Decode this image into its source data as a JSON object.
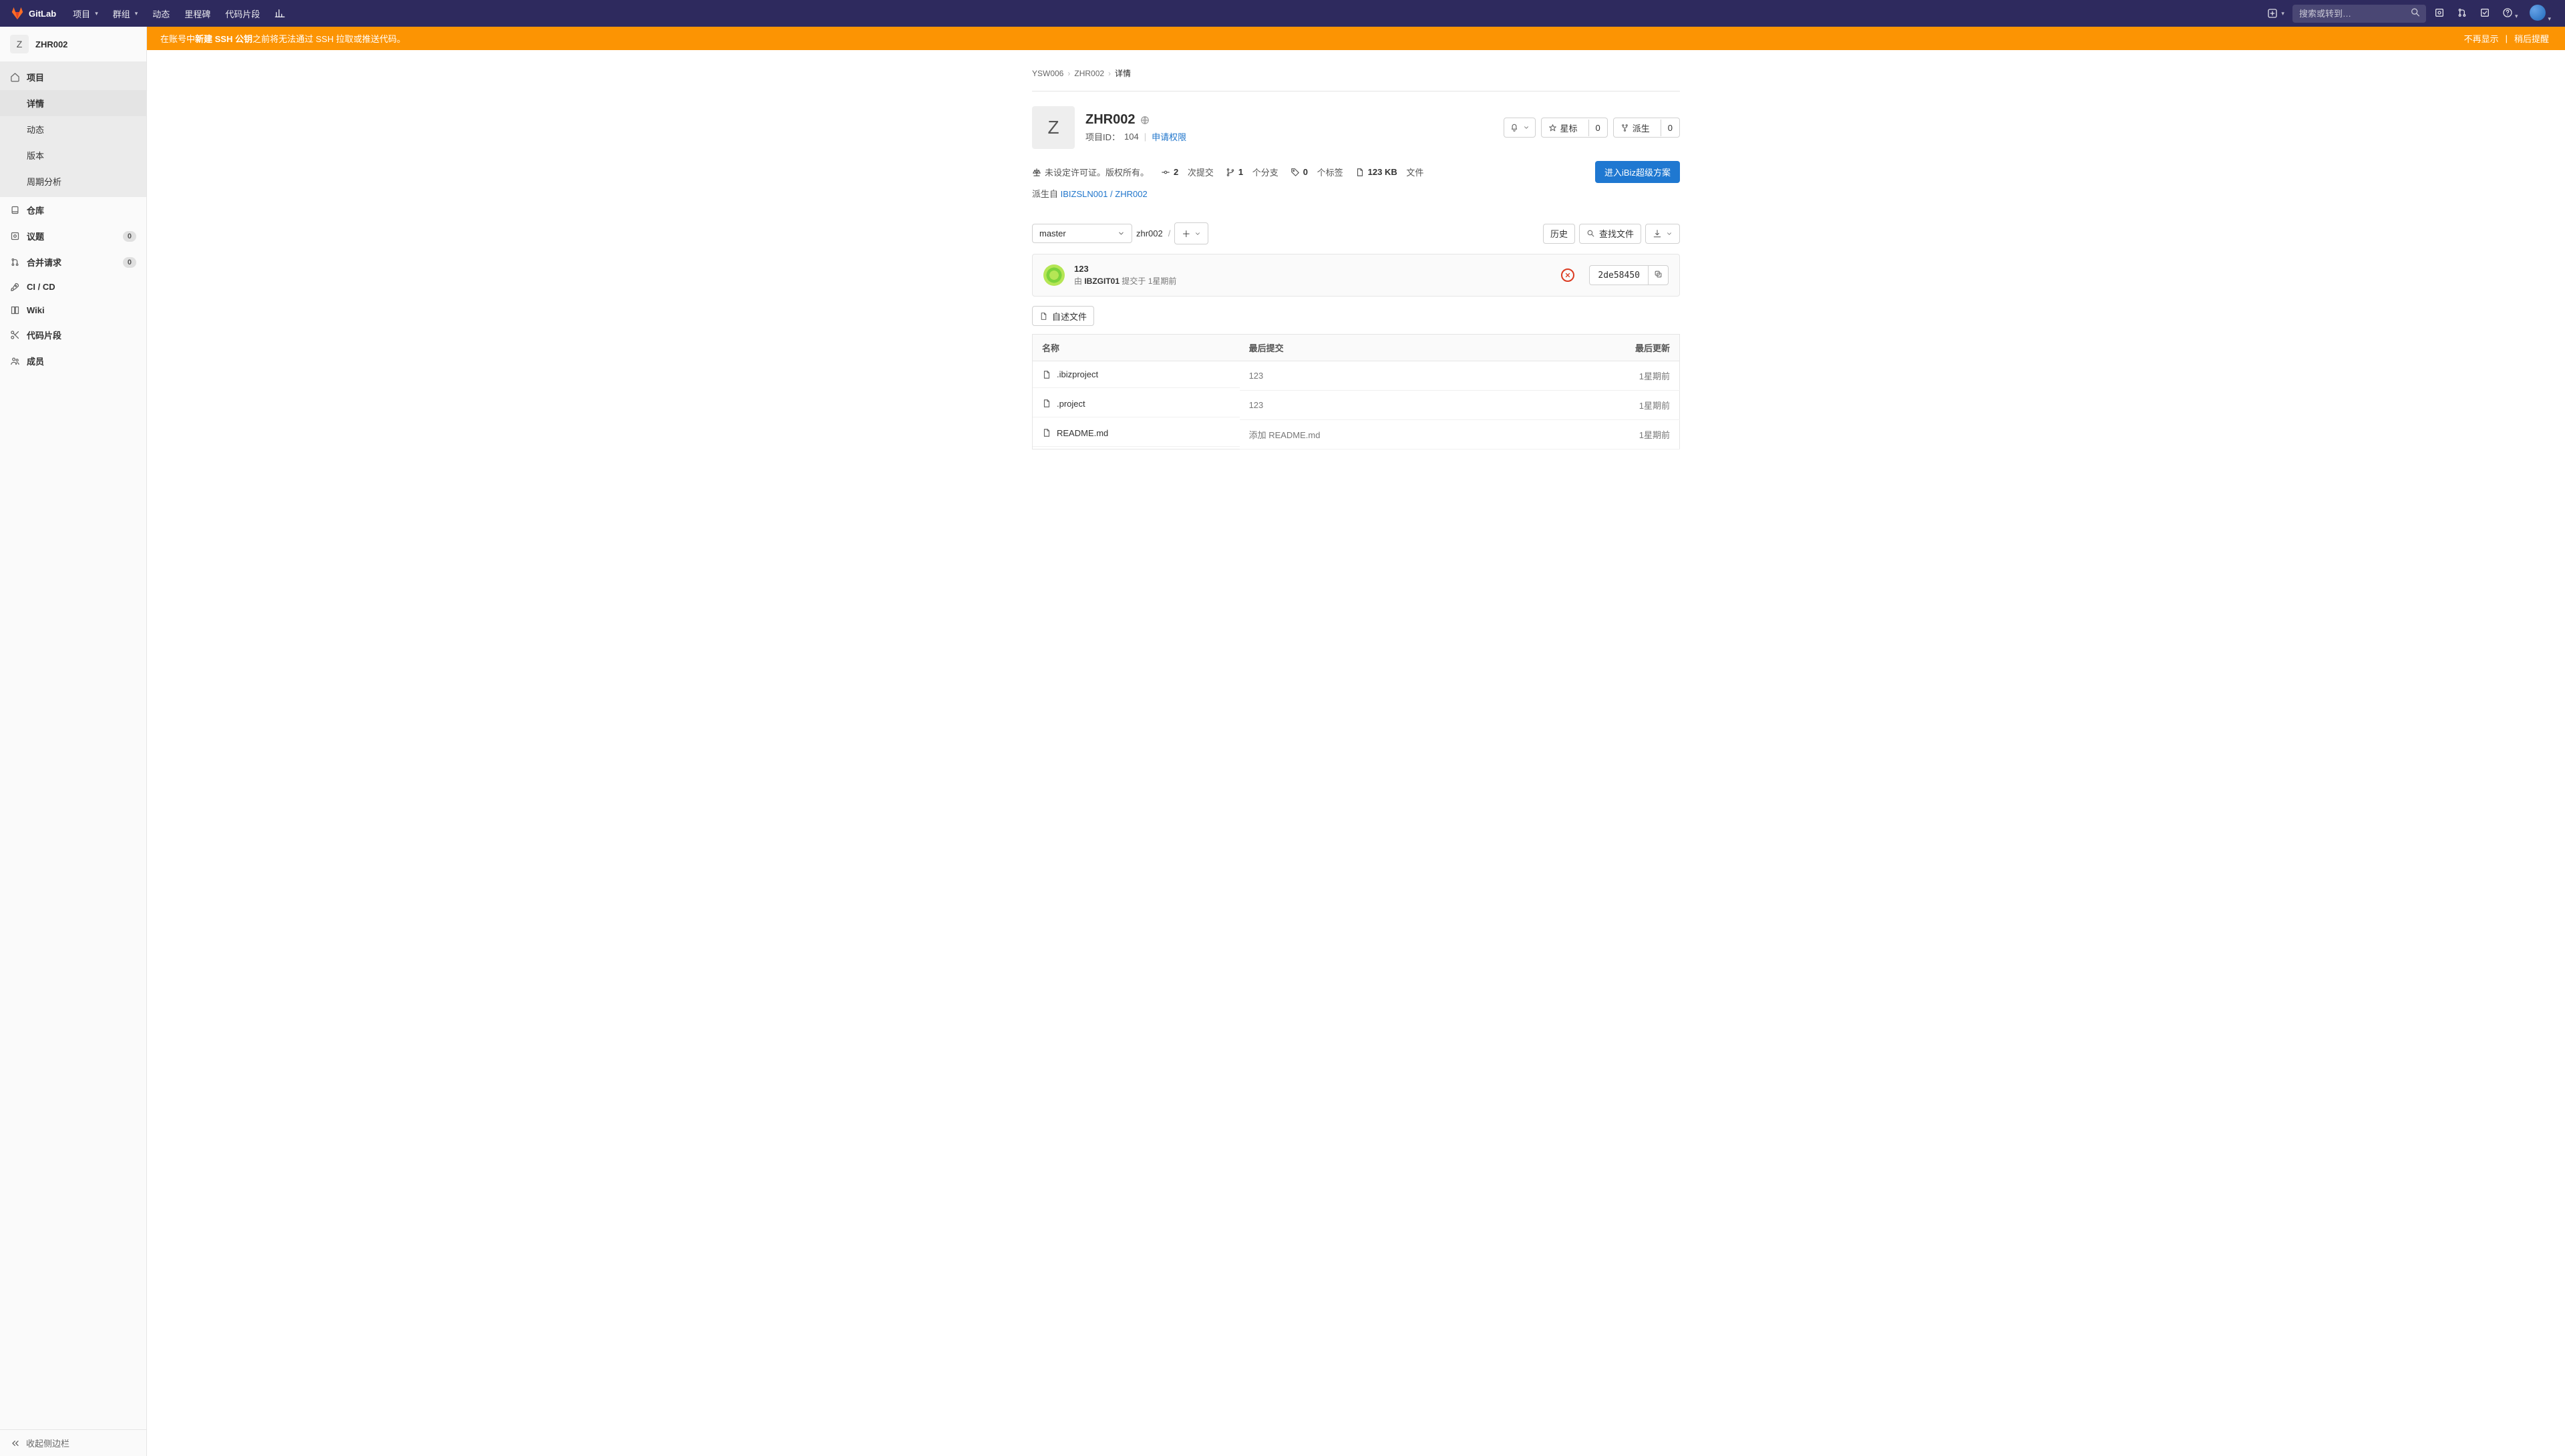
{
  "nav": {
    "brand": "GitLab",
    "items": [
      "项目",
      "群组",
      "动态",
      "里程碑",
      "代码片段"
    ],
    "search_placeholder": "搜索或转到…"
  },
  "sidebar": {
    "project_letter": "Z",
    "project_name": "ZHR002",
    "project": {
      "label": "项目",
      "subs": [
        "详情",
        "动态",
        "版本",
        "周期分析"
      ],
      "active_sub": 0
    },
    "items": [
      {
        "label": "仓库"
      },
      {
        "label": "议题",
        "badge": "0"
      },
      {
        "label": "合并请求",
        "badge": "0"
      },
      {
        "label": "CI / CD"
      },
      {
        "label": "Wiki"
      },
      {
        "label": "代码片段"
      },
      {
        "label": "成员"
      }
    ],
    "collapse": "收起侧边栏"
  },
  "banner": {
    "prefix": "在账号中 ",
    "link": "新建 SSH 公钥",
    "suffix": " 之前将无法通过 SSH 拉取或推送代码。",
    "dismiss": "不再显示",
    "remind": "稍后提醒"
  },
  "breadcrumbs": {
    "owner": "YSW006",
    "name": "ZHR002",
    "current": "详情"
  },
  "project": {
    "letter": "Z",
    "name": "ZHR002",
    "id_label": "项目ID：",
    "id": "104",
    "req_access": "申请权限",
    "star_label": "星标",
    "star_count": "0",
    "fork_label": "派生",
    "fork_count": "0",
    "enter_ibiz": "进入iBiz超级方案"
  },
  "stats": {
    "license": "未设定许可证。版权所有。",
    "commits_n": "2",
    "commits_t": "次提交",
    "branches_n": "1",
    "branches_t": "个分支",
    "tags_n": "0",
    "tags_t": "个标签",
    "files_n": "123 KB",
    "files_t": "文件"
  },
  "fork": {
    "prefix": "派生自 ",
    "link": "IBIZSLN001 / ZHR002"
  },
  "filebar": {
    "branch": "master",
    "path": "zhr002",
    "history": "历史",
    "find": "查找文件"
  },
  "commit": {
    "title": "123",
    "by": "由 ",
    "author": "IBZGIT01",
    "at": " 提交于 ",
    "when": "1星期前",
    "sha": "2de58450"
  },
  "readme_btn": "自述文件",
  "table": {
    "cols": {
      "name": "名称",
      "last_commit": "最后提交",
      "updated": "最后更新"
    },
    "rows": [
      {
        "name": ".ibizproject",
        "commit": "123",
        "updated": "1星期前"
      },
      {
        "name": ".project",
        "commit": "123",
        "updated": "1星期前"
      },
      {
        "name": "README.md",
        "commit": "添加 README.md",
        "updated": "1星期前"
      }
    ]
  }
}
